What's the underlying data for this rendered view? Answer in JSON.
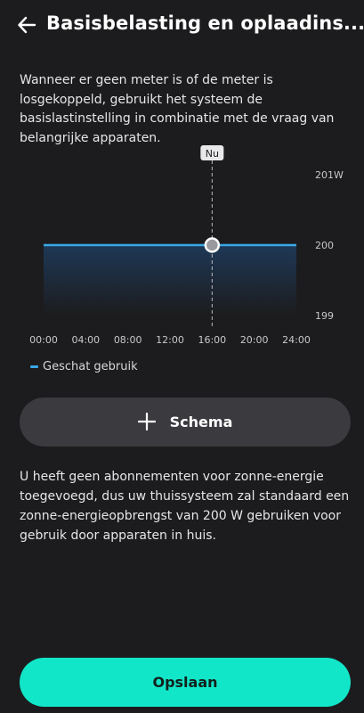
{
  "header": {
    "back_icon": "arrow-left-icon",
    "title": "Basisbelasting en oplaadins..."
  },
  "intro_text": "Wanneer er geen meter is of de meter is losgekoppeld, gebruikt het systeem de basislastinstelling in combinatie met de vraag van belangrijke apparaten.",
  "chart_data": {
    "type": "area",
    "x_ticks": [
      "00:00",
      "04:00",
      "08:00",
      "12:00",
      "16:00",
      "20:00",
      "24:00"
    ],
    "y_ticks": [
      "201W",
      "200",
      "199"
    ],
    "ylim": [
      199,
      201
    ],
    "now_label": "Nu",
    "now_time": "16:00",
    "series": [
      {
        "name": "Geschat gebruik",
        "color": "#3aa7e8",
        "x": [
          "00:00",
          "24:00"
        ],
        "values": [
          200,
          200
        ]
      }
    ],
    "legend": "bottom-left"
  },
  "schema_button": {
    "label": "Schema",
    "icon": "plus-icon"
  },
  "info_text": "U heeft geen abonnementen voor zonne-energie toegevoegd, dus uw thuissysteem zal standaard een zonne-energieopbrengst van 200 W gebruiken voor gebruik door apparaten in huis.",
  "save_button": {
    "label": "Opslaan"
  },
  "colors": {
    "background": "#1c1c1e",
    "accent": "#12e6c8",
    "series": "#3aa7e8",
    "button_secondary": "#3a3a3f"
  }
}
